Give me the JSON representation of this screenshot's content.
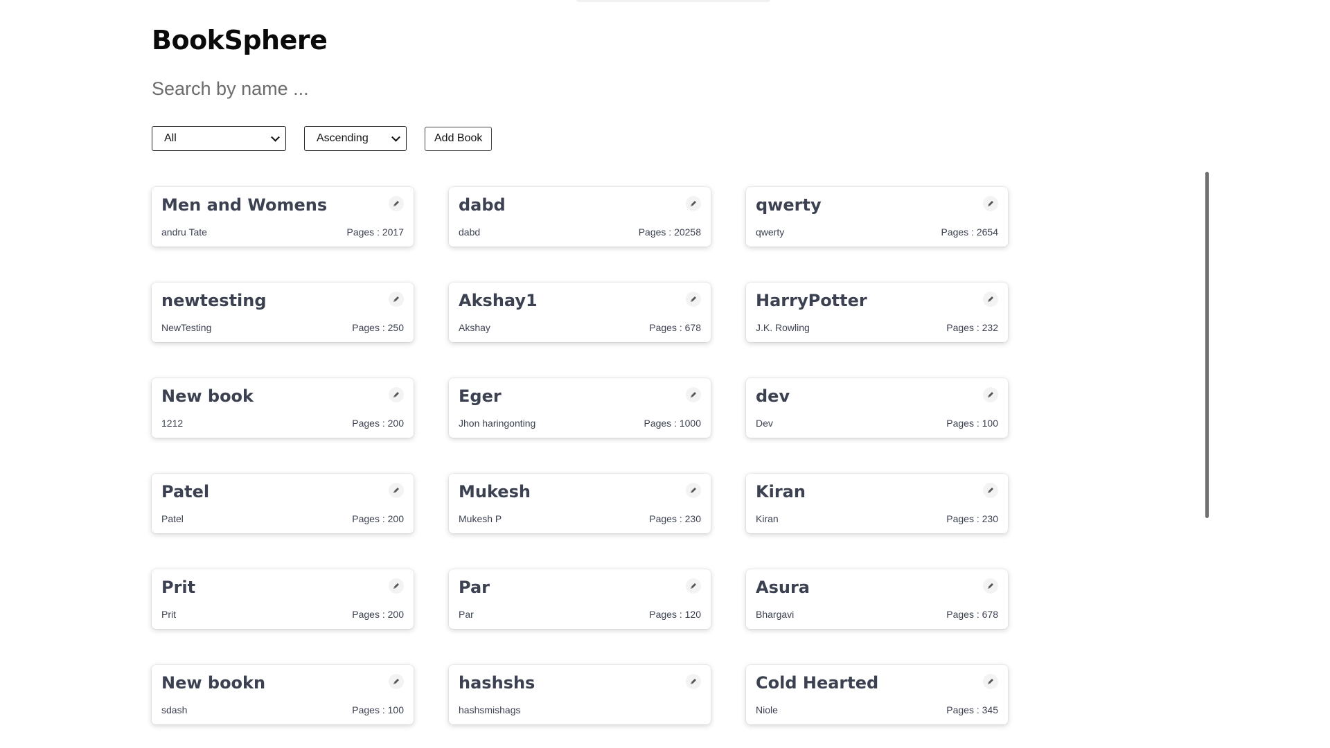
{
  "app": {
    "title": "BookSphere"
  },
  "search": {
    "placeholder": "Search by name ...",
    "value": ""
  },
  "filters": {
    "category_selected": "All",
    "sort_selected": "Ascending",
    "add_button_label": "Add Book"
  },
  "icons": {
    "edit": "pencil-icon",
    "dropdown": "chevron-down-icon"
  },
  "books": [
    {
      "title": "Men and Womens",
      "author": "andru Tate",
      "pages": "Pages : 2017"
    },
    {
      "title": "dabd",
      "author": "dabd",
      "pages": "Pages : 20258"
    },
    {
      "title": "qwerty",
      "author": "qwerty",
      "pages": "Pages : 2654"
    },
    {
      "title": "newtesting",
      "author": "NewTesting",
      "pages": "Pages : 250"
    },
    {
      "title": "Akshay1",
      "author": "Akshay",
      "pages": "Pages : 678"
    },
    {
      "title": "HarryPotter",
      "author": "J.K. Rowling",
      "pages": "Pages : 232"
    },
    {
      "title": "New book",
      "author": "1212",
      "pages": "Pages : 200"
    },
    {
      "title": "Eger",
      "author": "Jhon haringonting",
      "pages": "Pages : 1000"
    },
    {
      "title": "dev",
      "author": "Dev",
      "pages": "Pages : 100"
    },
    {
      "title": "Patel",
      "author": "Patel",
      "pages": "Pages : 200"
    },
    {
      "title": "Mukesh",
      "author": "Mukesh P",
      "pages": "Pages : 230"
    },
    {
      "title": "Kiran",
      "author": "Kiran",
      "pages": "Pages : 230"
    },
    {
      "title": "Prit",
      "author": "Prit",
      "pages": "Pages : 200"
    },
    {
      "title": "Par",
      "author": "Par",
      "pages": "Pages : 120"
    },
    {
      "title": "Asura",
      "author": "Bhargavi",
      "pages": "Pages : 678"
    },
    {
      "title": "New bookn",
      "author": "sdash",
      "pages": "Pages : 100"
    },
    {
      "title": "hashshs",
      "author": "hashsmishags",
      "pages": ""
    },
    {
      "title": "Cold Hearted",
      "author": "Niole",
      "pages": "Pages : 345"
    }
  ]
}
